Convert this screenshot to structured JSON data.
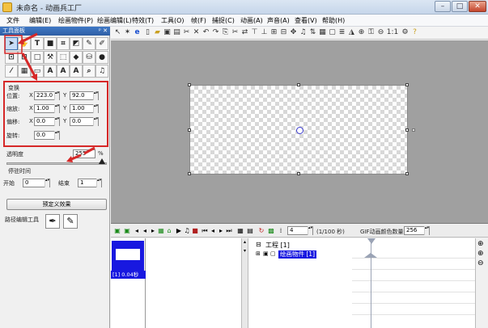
{
  "window": {
    "title": "未命名 - 动画兵工厂"
  },
  "menu": [
    {
      "label": "文件"
    },
    {
      "label": "编辑(E)"
    },
    {
      "label": "绘画物件(P)"
    },
    {
      "label": "绘画编辑(L)"
    },
    {
      "label": "特效(T)"
    },
    {
      "label": "工具(O)"
    },
    {
      "label": "帧(F)"
    },
    {
      "label": "捕捉(C)"
    },
    {
      "label": "动画(A)"
    },
    {
      "label": "声音(A)"
    },
    {
      "label": "查看(V)"
    },
    {
      "label": "帮助(H)"
    }
  ],
  "toolbox": {
    "title": "工具面板",
    "transform": {
      "title": "变换",
      "position": {
        "label": "位置:",
        "x": "223.0",
        "y": "92.0"
      },
      "scale": {
        "label": "缩放:",
        "x": "1.00",
        "y": "1.00"
      },
      "skew": {
        "label": "偏移:",
        "x": "0.0",
        "y": "0.0"
      },
      "rotate": {
        "label": "旋转:",
        "value": "0.0"
      },
      "x_label": "X",
      "y_label": "Y"
    },
    "opacity": {
      "label": "透明度",
      "value": "255",
      "unit": "%"
    },
    "stop_time": {
      "title": "停驻时间",
      "start_label": "开始",
      "start_value": "0",
      "end_label": "结束",
      "end_value": "1"
    },
    "preset_button": "预定义效果",
    "path_edit_label": "路径编辑工具"
  },
  "timeline": {
    "zoom": "1:1",
    "frame_value": "4",
    "frame_unit": "(1/100 秒)",
    "gif_label": "GIF动画颜色数量",
    "gif_value": "256",
    "frame_label": "[1] 0.04秒",
    "project_label": "工程 [1]",
    "layer_label": "绘画物件 [1]"
  },
  "colors": {
    "accent_red": "#d62828",
    "selection_blue": "#1818e0"
  }
}
